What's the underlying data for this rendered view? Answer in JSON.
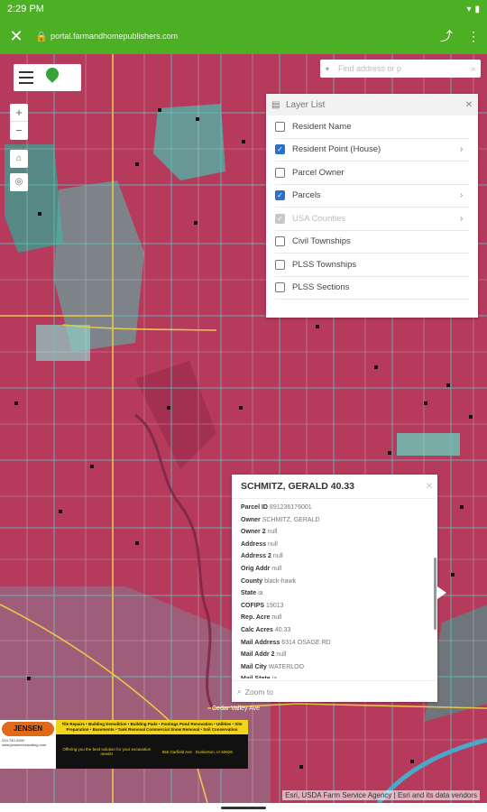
{
  "status": {
    "time": "2:29 PM",
    "wifi": "▾",
    "battery": "▮"
  },
  "browser": {
    "close_icon": "✕",
    "url": "portal.farmandhomepublishers.com",
    "share_icon": "⤴",
    "menu_icon": "⋮"
  },
  "search": {
    "placeholder": "Find address or p"
  },
  "zoom": {
    "in": "+",
    "out": "−"
  },
  "layer_list": {
    "title": "Layer List",
    "items": [
      {
        "label": "Resident Name",
        "checked": false,
        "disabled": false,
        "has_arrow": false
      },
      {
        "label": "Resident Point (House)",
        "checked": true,
        "disabled": false,
        "has_arrow": true
      },
      {
        "label": "Parcel Owner",
        "checked": false,
        "disabled": false,
        "has_arrow": false
      },
      {
        "label": "Parcels",
        "checked": true,
        "disabled": false,
        "has_arrow": true
      },
      {
        "label": "USA Counties",
        "checked": true,
        "disabled": true,
        "has_arrow": true
      },
      {
        "label": "Civil Townships",
        "checked": false,
        "disabled": false,
        "has_arrow": false
      },
      {
        "label": "PLSS Townships",
        "checked": false,
        "disabled": false,
        "has_arrow": false
      },
      {
        "label": "PLSS Sections",
        "checked": false,
        "disabled": false,
        "has_arrow": false
      }
    ]
  },
  "popup": {
    "title": "SCHMITZ, GERALD 40.33",
    "fields": [
      {
        "k": "Parcel ID",
        "v": "891236176001"
      },
      {
        "k": "Owner",
        "v": "SCHMITZ, GERALD"
      },
      {
        "k": "Owner 2",
        "v": "null"
      },
      {
        "k": "Address",
        "v": "null"
      },
      {
        "k": "Address 2",
        "v": "null"
      },
      {
        "k": "Orig Addr",
        "v": "null"
      },
      {
        "k": "County",
        "v": "black-hawk"
      },
      {
        "k": "State",
        "v": "ia"
      },
      {
        "k": "COFIPS",
        "v": "19013"
      },
      {
        "k": "Rep. Acre",
        "v": "null"
      },
      {
        "k": "Calc Acres",
        "v": "40.33"
      },
      {
        "k": "Mail Address",
        "v": "6314 OSAGE RD"
      },
      {
        "k": "Mail Addr 2",
        "v": "null"
      },
      {
        "k": "Mail City",
        "v": "WATERLOO"
      },
      {
        "k": "Mail State",
        "v": "ia"
      }
    ],
    "zoom_to": "Zoom to"
  },
  "ad": {
    "brand": "JENSEN",
    "phone_lines": "319-740-3940 · www.jensenexcavating.com",
    "services": "Tile Repairs • Building Demolition • Building Pads • Footings\nPond Renovation • Utilities • Site Preparation • Basements • Tank Removal\nCommercial Snow Removal • Soil Conservation",
    "tagline": "Offering you the best solution for your excavation needs!",
    "address": "655 Garfield Ave · Dunkerton, IA 50626"
  },
  "map": {
    "road_label": "Cedar Valley Ave",
    "attribution": "Esri, USDA Farm Service Agency | Esri and its data vendors"
  }
}
